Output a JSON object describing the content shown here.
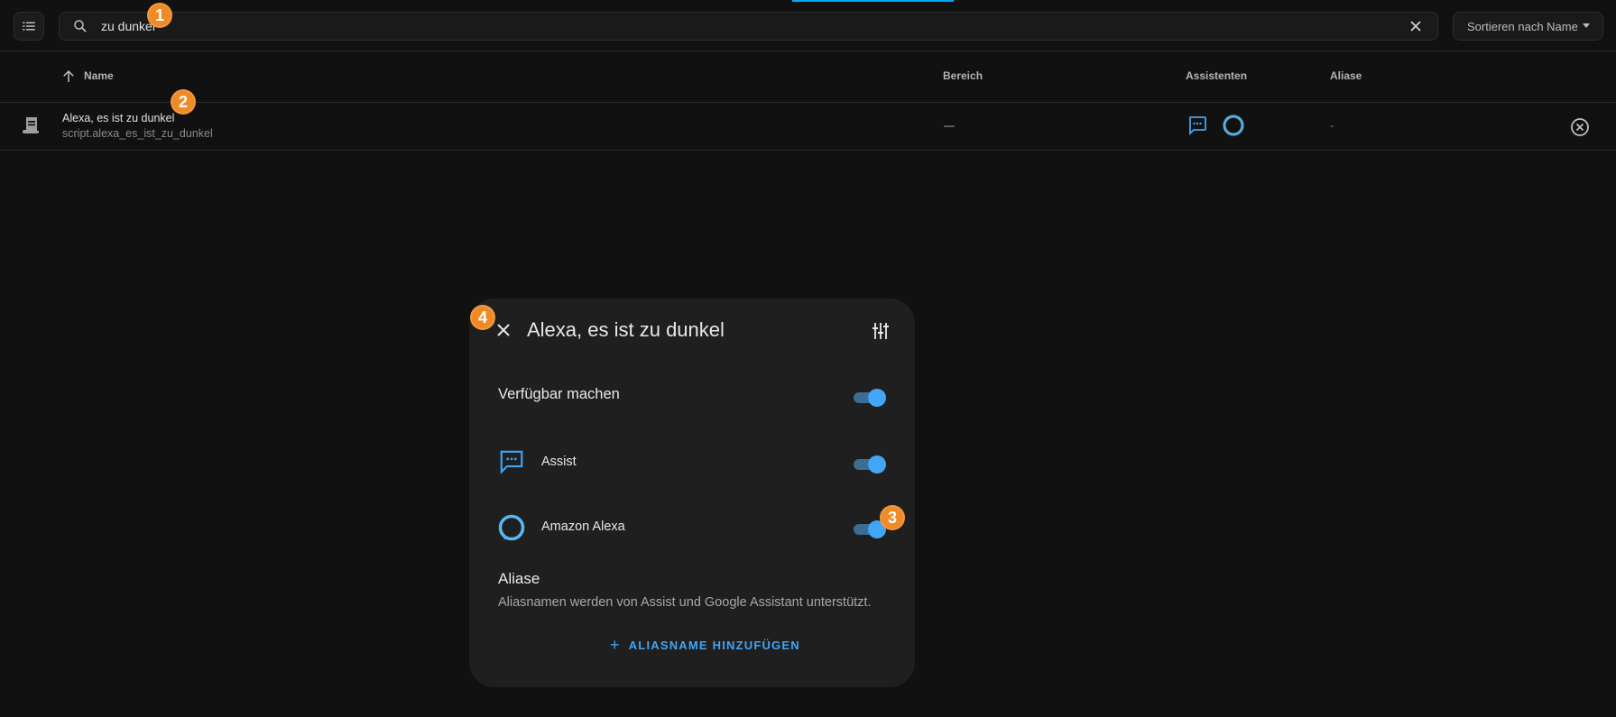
{
  "search": {
    "value": "zu dunkel"
  },
  "sort": {
    "label": "Sortieren nach Name"
  },
  "table": {
    "headers": {
      "name": "Name",
      "area": "Bereich",
      "assistants": "Assistenten",
      "aliases": "Aliase"
    },
    "rows": [
      {
        "name": "Alexa, es ist zu dunkel",
        "entity_id": "script.alexa_es_ist_zu_dunkel",
        "area": "—",
        "aliases": "-",
        "icon": "script-icon",
        "assistants": [
          "assist-icon",
          "alexa-icon"
        ]
      }
    ]
  },
  "badges": [
    "1",
    "2",
    "3",
    "4"
  ],
  "dialog": {
    "title": "Alexa, es ist zu dunkel",
    "expose_label": "Verfügbar machen",
    "expose_on": true,
    "assistants": [
      {
        "label": "Assist",
        "on": true,
        "icon": "assist-icon"
      },
      {
        "label": "Amazon Alexa",
        "on": true,
        "icon": "alexa-icon"
      }
    ],
    "aliases_heading": "Aliase",
    "aliases_description": "Aliasnamen werden von Assist und Google Assistant unterstützt.",
    "add_alias_label": "ALIASNAME HINZUFÜGEN"
  },
  "colors": {
    "accent": "#42a5f5",
    "badge": "#f08a24",
    "background": "#111111",
    "dialog": "#1f1f1f"
  }
}
